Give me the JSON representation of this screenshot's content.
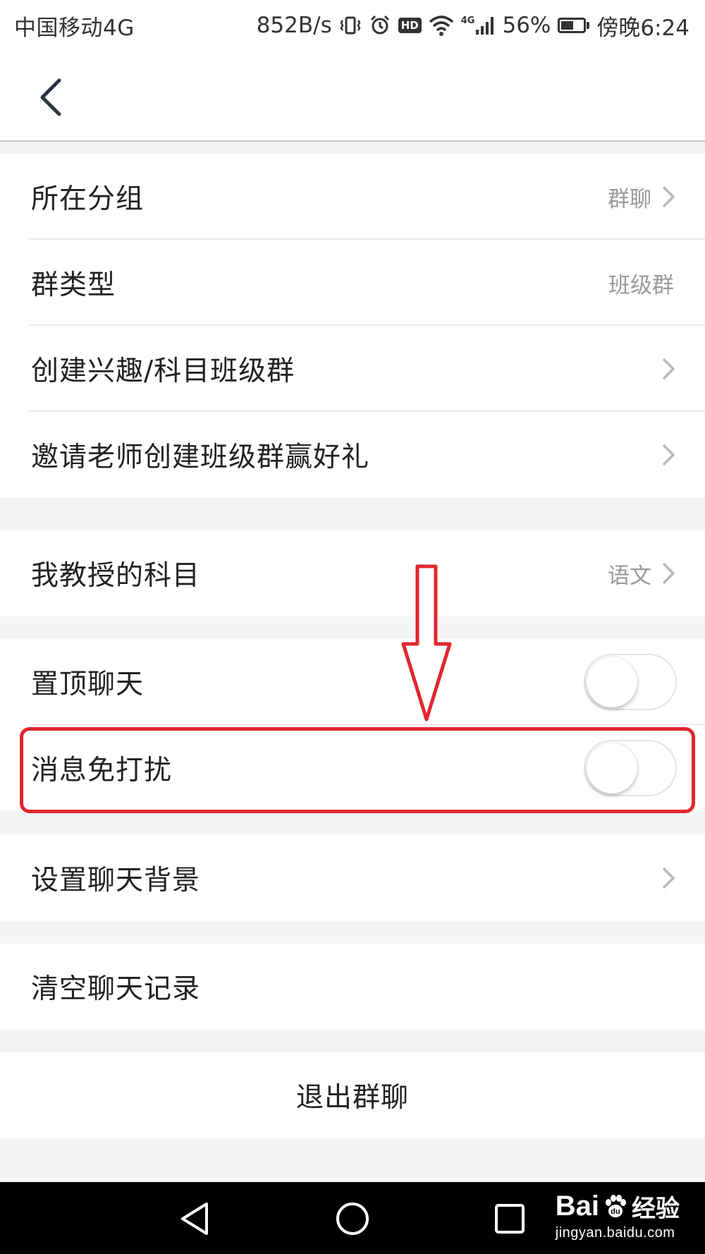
{
  "status_bar": {
    "carrier": "中国移动4G",
    "speed": "852B/s",
    "hd": "HD",
    "network": "4G",
    "battery": "56%",
    "battery_level": 0.56,
    "time": "傍晚6:24"
  },
  "sections": [
    {
      "rows": [
        {
          "label": "所在分组",
          "value": "群聊",
          "chevron": true
        },
        {
          "label": "群类型",
          "value": "班级群",
          "chevron": false
        },
        {
          "label": "创建兴趣/科目班级群",
          "value": "",
          "chevron": true
        },
        {
          "label": "邀请老师创建班级群赢好礼",
          "value": "",
          "chevron": true
        }
      ]
    },
    {
      "rows": [
        {
          "label": "我教授的科目",
          "value": "语文",
          "chevron": true
        }
      ]
    },
    {
      "rows": [
        {
          "label": "置顶聊天",
          "toggle_on": false
        },
        {
          "label": "消息免打扰",
          "toggle_on": false
        }
      ]
    },
    {
      "rows": [
        {
          "label": "设置聊天背景",
          "value": "",
          "chevron": true
        }
      ]
    },
    {
      "rows": [
        {
          "label": "清空聊天记录"
        }
      ]
    }
  ],
  "exit_button": "退出群聊",
  "watermark": {
    "main": "Bai",
    "paw": "du",
    "suffix": "经验",
    "sub": "jingyan.baidu.com"
  },
  "colors": {
    "annotation_red": "#e0262f",
    "background": "#f3f4f6",
    "chevron": "#b8b8b8"
  },
  "icons": [
    "back-arrow-icon",
    "chevron-right-icon",
    "nav-back-icon",
    "nav-home-icon",
    "nav-recents-icon"
  ]
}
